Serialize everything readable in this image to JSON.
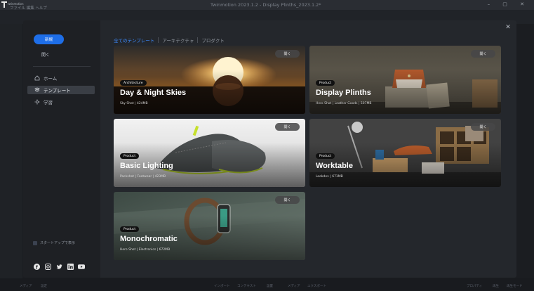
{
  "app": {
    "logo_text": "twinmotion",
    "menu": "ファイル 編集 ヘルプ",
    "window_title": "Twinmotion 2023.1.2 - Display Plinths_2023.1.2*",
    "window_controls": "– ▢ ✕"
  },
  "sidebar": {
    "new_button": "新規",
    "open_link": "開く",
    "items": [
      {
        "label": "ホーム",
        "icon": "home-icon"
      },
      {
        "label": "テンプレート",
        "icon": "template-icon",
        "active": true
      },
      {
        "label": "学習",
        "icon": "learn-icon"
      }
    ],
    "startup_label": "スタートアップで表示",
    "social": [
      "facebook-icon",
      "instagram-icon",
      "twitter-icon",
      "linkedin-icon",
      "youtube-icon"
    ]
  },
  "tabs": [
    {
      "label": "全てのテンプレート",
      "active": true
    },
    {
      "label": "アーキテクチャ"
    },
    {
      "label": "プロダクト"
    }
  ],
  "open_button_label": "開く",
  "cards": [
    {
      "badge": "Architecture",
      "title": "Day & Night Skies",
      "meta": "Sky Shot | 424MB"
    },
    {
      "badge": "Product",
      "title": "Display Plinths",
      "meta": "Hero Shot | Leather Goods | 507MB"
    },
    {
      "badge": "Product",
      "title": "Basic Lighting",
      "meta": "Packshot | Footwear | 423MB"
    },
    {
      "badge": "Product",
      "title": "Worktable",
      "meta": "Lookdev | 671MB"
    },
    {
      "badge": "Product",
      "title": "Monochromatic",
      "meta": "Hero Shot | Electronics | 672MB"
    }
  ],
  "bottom_bar": [
    "メディア",
    "設定",
    "インポート",
    "コンテキスト",
    "設置",
    "メディア",
    "エクスポート",
    "プロパティ",
    "再生",
    "再生モード"
  ],
  "colors": {
    "accent": "#1e6ee8",
    "tab_active": "#3d8bff"
  }
}
